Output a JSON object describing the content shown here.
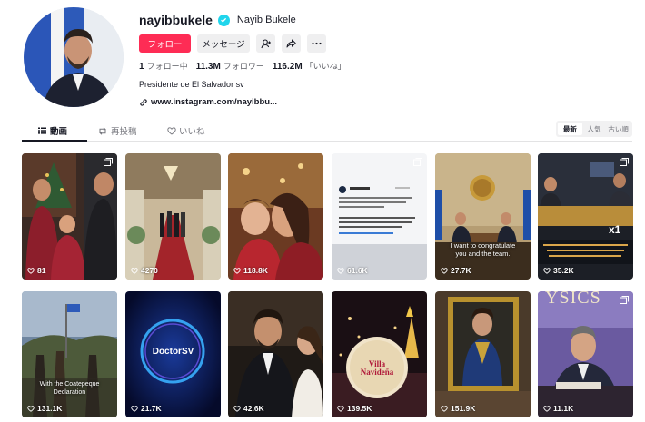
{
  "profile": {
    "username": "nayibbukele",
    "nickname": "Nayib Bukele",
    "follow_label": "フォロー",
    "message_label": "メッセージ",
    "following_count": "1",
    "following_label": "フォロー中",
    "followers_count": "11.3M",
    "followers_label": "フォロワー",
    "likes_count": "116.2M",
    "likes_label": "「いいね」",
    "bio": "Presidente de El Salvador sv",
    "link": "www.instagram.com/nayibbu..."
  },
  "tabs": {
    "videos": "動画",
    "reposts": "再投稿",
    "likes": "いいね"
  },
  "sort": {
    "latest": "最新",
    "popular": "人気",
    "oldest": "古い順"
  },
  "videos": [
    {
      "views": "81"
    },
    {
      "views": "4270"
    },
    {
      "views": "118.8K"
    },
    {
      "views": "61.6K"
    },
    {
      "views": "27.7K",
      "caption": "I want to congratulate you and the team."
    },
    {
      "views": "35.2K"
    },
    {
      "views": "131.1K",
      "caption": "With the Coatepeque Declaration"
    },
    {
      "views": "21.7K",
      "overlay": "DoctorSV"
    },
    {
      "views": "42.6K"
    },
    {
      "views": "139.5K",
      "overlay": "Villa Navideña"
    },
    {
      "views": "151.9K"
    },
    {
      "views": "11.1K",
      "overlay": "YSICS"
    }
  ],
  "colors": {
    "accent": "#fe2c55",
    "verified": "#20d5ec"
  }
}
